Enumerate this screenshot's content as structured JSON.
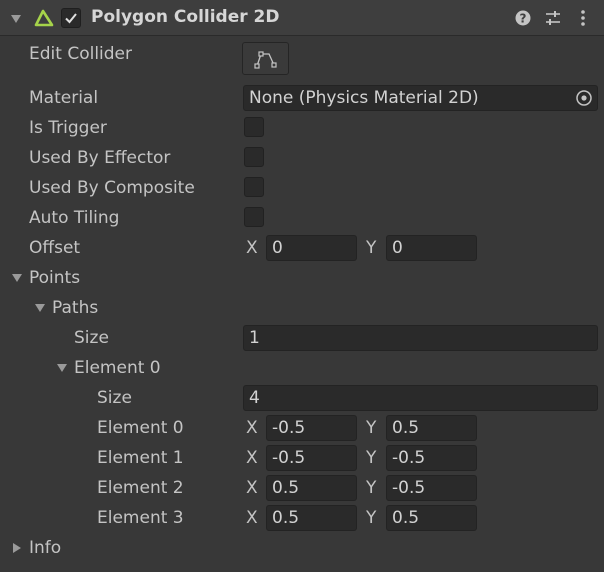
{
  "component": {
    "title": "Polygon Collider 2D",
    "enabled": true,
    "icons": [
      "polygon-collider-icon",
      "help-icon",
      "presets-icon",
      "context-menu-icon"
    ]
  },
  "rows": {
    "edit_collider": "Edit Collider",
    "material": "Material",
    "material_value": "None (Physics Material 2D)",
    "is_trigger": "Is Trigger",
    "used_by_effector": "Used By Effector",
    "used_by_composite": "Used By Composite",
    "auto_tiling": "Auto Tiling",
    "offset": "Offset",
    "offset_x": "0",
    "offset_y": "0"
  },
  "points": {
    "label": "Points",
    "paths": {
      "label": "Paths",
      "size_label": "Size",
      "size": "1",
      "element0": {
        "label": "Element 0",
        "size_label": "Size",
        "size": "4",
        "elements": [
          {
            "label": "Element 0",
            "x": "-0.5",
            "y": "0.5"
          },
          {
            "label": "Element 1",
            "x": "-0.5",
            "y": "-0.5"
          },
          {
            "label": "Element 2",
            "x": "0.5",
            "y": "-0.5"
          },
          {
            "label": "Element 3",
            "x": "0.5",
            "y": "0.5"
          }
        ]
      }
    }
  },
  "info": {
    "label": "Info"
  },
  "axis": {
    "x": "X",
    "y": "Y"
  },
  "colors": {
    "accent": "#a6d34a",
    "background": "#383838",
    "field": "#2a2a2a"
  }
}
